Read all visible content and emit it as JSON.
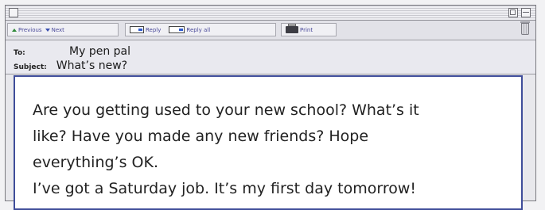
{
  "toolbar": {
    "previous_label": "Previous",
    "next_label": "Next",
    "reply_label": "Reply",
    "reply_all_label": "Reply all",
    "print_label": "Print"
  },
  "header": {
    "to_label": "To:",
    "to_value": "My pen pal",
    "subject_label": "Subject:",
    "subject_value": "What’s new?"
  },
  "body": {
    "paragraph_1": "Are you getting used to your new school? What’s it\nlike? Have you made any new friends? Hope\neverything’s OK.",
    "paragraph_2": "I’ve got a Saturday job. It’s my first day tomorrow!"
  },
  "icons": {
    "previous": "arrow-up-icon",
    "next": "arrow-down-icon",
    "reply": "mail-reply-icon",
    "reply_all": "mail-reply-all-icon",
    "print": "printer-icon",
    "trash": "trash-icon"
  },
  "colors": {
    "toolbar_text": "#4a4a9a",
    "body_border": "#3f4d9a"
  }
}
